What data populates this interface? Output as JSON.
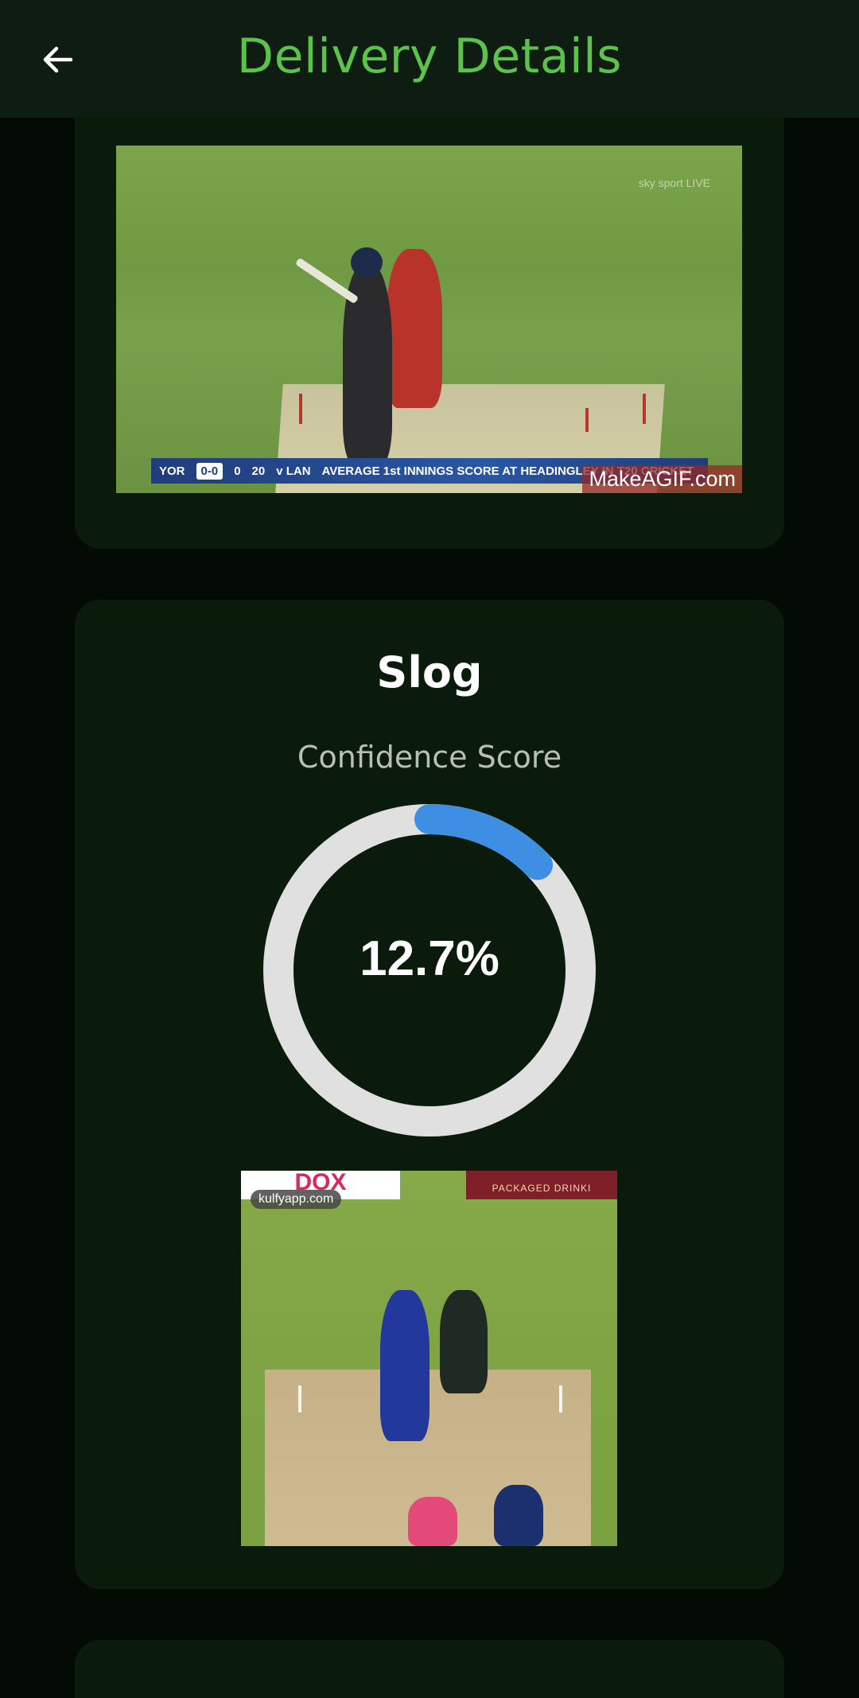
{
  "header": {
    "title": "Delivery Details",
    "back_icon": "arrow-left-icon"
  },
  "video_card": {
    "frame_label": "MakeAGIF.com",
    "scorebar": {
      "team": "YOR",
      "score": "0-0",
      "overs": "0",
      "target": "20",
      "opponent": "v LAN",
      "ticker": "AVERAGE 1st INNINGS SCORE AT HEADINGLEY IN T20 CRICKET"
    },
    "channel_logo": "sky sport LIVE"
  },
  "classification": {
    "shot_name": "Slog",
    "confidence_label": "Confidence Score",
    "confidence_value": 12.7,
    "confidence_text": "12.7%",
    "gauge_track_color": "#e0e0e0",
    "gauge_fill_color": "#3e8ee3"
  },
  "example_clip": {
    "source_label": "kulfyapp.com",
    "ad_right": "PACKAGED DRINKI"
  },
  "colors": {
    "background": "#040b05",
    "card": "#0a1b0b",
    "header": "#0f1c12",
    "title_green": "#5cc24c"
  }
}
